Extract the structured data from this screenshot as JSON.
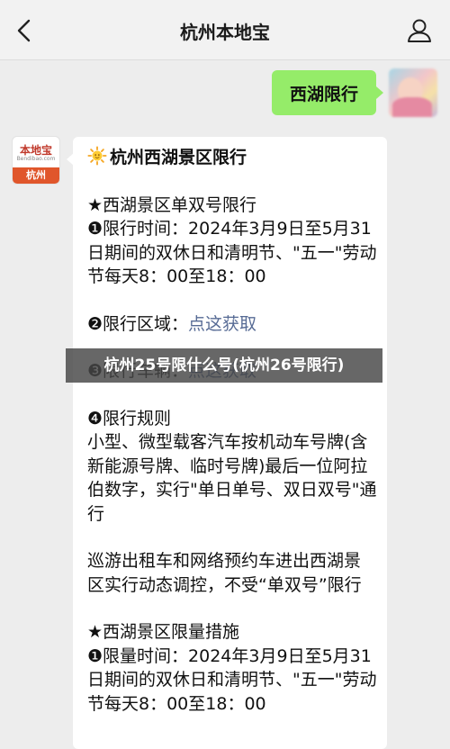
{
  "header": {
    "title": "杭州本地宝"
  },
  "chat": {
    "outgoing": {
      "text": "西湖限行"
    },
    "bot_logo": {
      "name": "本地宝",
      "sub": "Bendibao.com",
      "city": "杭州"
    },
    "incoming": {
      "heading": "杭州西湖景区限行",
      "lines": [
        {
          "text": "★西湖景区单双号限行",
          "type": "text"
        },
        {
          "text": "❶限行时间：2024年3月9日至5月31日期间的双休日和清明节、\"五一\"劳动节每天8：00至18：00",
          "type": "text"
        },
        {
          "text": "",
          "type": "gap"
        },
        {
          "prefix": "❷限行区域：",
          "link": "点这获取",
          "type": "link"
        },
        {
          "prefix": "❸限行车辆：",
          "link": "点这获取",
          "type": "link"
        },
        {
          "text": "❹限行规则",
          "type": "text"
        },
        {
          "text": "小型、微型载客汽车按机动车号牌(含新能源号牌、临时号牌)最后一位阿拉伯数字，实行\"单日单号、双日双号\"通行",
          "type": "text"
        },
        {
          "text": "",
          "type": "gap"
        },
        {
          "text": "巡游出租车和网络预约车进出西湖景区实行动态调控，不受“单双号”限行",
          "type": "text"
        },
        {
          "text": "",
          "type": "gap"
        },
        {
          "text": "★西湖景区限量措施",
          "type": "text"
        },
        {
          "text": "❶限量时间：2024年3月9日至5月31日期间的双休日和清明节、\"五一\"劳动节每天8：00至18：00",
          "type": "text"
        }
      ]
    }
  },
  "overlay": {
    "title": "杭州25号限什么号(杭州26号限行)"
  },
  "colors": {
    "bubble_out": "#95ec69",
    "link": "#576b95",
    "logo_red": "#e0562b"
  }
}
